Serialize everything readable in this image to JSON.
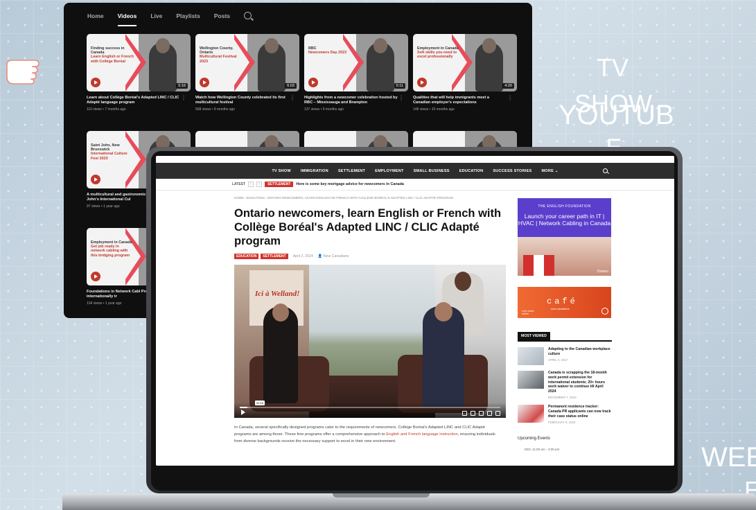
{
  "floating_labels": {
    "tv": "TV",
    "show": "SHOW",
    "youtube": "YOUTUB",
    "e": "E",
    "web": "WEE",
    "e2": "E"
  },
  "youtube": {
    "tabs": [
      "Home",
      "Videos",
      "Live",
      "Playlists",
      "Posts"
    ],
    "active_tab": "Videos",
    "videos": [
      {
        "thumb_kicker": "Finding success in Canada",
        "thumb_title": "Learn English or French with Collège Boréal",
        "duration": "5:16",
        "title": "Learn about Collège Boréal's Adapted LINC / CLIC Adapté language program",
        "meta": "110 views • 7 months ago"
      },
      {
        "thumb_kicker": "Wellington County, Ontario",
        "thumb_title": "Multicultural Festival 2023",
        "duration": "6:03",
        "title": "Watch how Wellington County celebrated its first multicultural festival",
        "meta": "568 views • 9 months ago"
      },
      {
        "thumb_kicker": "RBC",
        "thumb_title": "Newcomers Day 2023",
        "duration": "5:11",
        "title": "Highlights from a newcomer celebration hosted by RBC – Mississauga and Brampton",
        "meta": "137 views • 9 months ago"
      },
      {
        "thumb_kicker": "Employment in Canada",
        "thumb_title": "Soft skills you need to excel professionally",
        "duration": "4:20",
        "title": "Qualities that will help immigrants meet a Canadian employer's expectations",
        "meta": "148 views • 10 months ago"
      },
      {
        "thumb_kicker": "Saint John, New Brunswick",
        "thumb_title": "International Culture Fest 2023",
        "duration": "",
        "title": "A multicultural and gastronomic celebration: Saint John's International Cul",
        "meta": "97 views • 1 year ago"
      },
      {
        "thumb_kicker": "",
        "thumb_title": "",
        "duration": "",
        "title": "",
        "meta": ""
      },
      {
        "thumb_kicker": "",
        "thumb_title": "",
        "duration": "",
        "title": "",
        "meta": ""
      },
      {
        "thumb_kicker": "",
        "thumb_title": "",
        "duration": "",
        "title": "",
        "meta": ""
      },
      {
        "thumb_kicker": "Employment in Canada",
        "thumb_title": "Get job ready in network cabling with this bridging program",
        "duration": "",
        "title": "Foundations in Network Cabl Program for internationally tr",
        "meta": "134 views • 1 year ago"
      }
    ]
  },
  "site": {
    "nav": [
      "TV SHOW",
      "IMMIGRATION",
      "SETTLEMENT",
      "EMPLOYMENT",
      "SMALL BUSINESS",
      "EDUCATION",
      "SUCCESS STORIES",
      "MORE"
    ],
    "ticker_label": "LATEST",
    "ticker_tag": "SETTLEMENT",
    "ticker_text": "Here is some key mortgage advice for newcomers in Canada",
    "breadcrumb": "HOME  ›  EDUCATION  ›  ONTARIO NEWCOMERS, LEARN ENGLISH OR FRENCH WITH COLLÈGE BORÉAL'S ADAPTED LINC / CLIC ADAPTÉ PROGRAM",
    "headline": "Ontario newcomers, learn English or French with Collège Boréal's Adapted LINC / CLIC Adapté program",
    "tags": [
      "EDUCATION",
      "SETTLEMENT"
    ],
    "date": "April 2, 2024",
    "author": "New Canadians",
    "video_sign": "Ici à Welland!",
    "video_time": "00:16",
    "video_progress": 0.03,
    "body_pre": "In Canada, several specifically designed programs cater to the requirements of newcomers. Collège Boréal's Adapted LINC and CLIC Adapté programs are among those. These free programs offer a comprehensive approach to ",
    "body_link": "English and French language instruction",
    "body_post": ", ensuring individuals from diverse backgrounds receive the necessary support to excel in their new environment.",
    "ad1": {
      "logo": "THE ENGLISH FOUNDATION",
      "headline": "Launch your career path in IT | HVAC | Network Cabling in Canada",
      "foot": "Ontario"
    },
    "ad2": {
      "logo": "Let's meet online",
      "text": "café",
      "sub": "new canadians"
    },
    "most_viewed_title": "MOST VIEWED",
    "most_viewed": [
      {
        "title": "Adapting to the Canadian workplace culture",
        "date": "APRIL 3, 2017"
      },
      {
        "title": "Canada is scrapping the 18-month work permit extension for international students; 20+ hours work waiver to continue till April 2024",
        "date": "DECEMBER 7, 2023"
      },
      {
        "title": "Permanent residence tracker: Canada PR applicants can now track their case status online",
        "date": "FEBRUARY 8, 2022"
      }
    ],
    "events_title": "Upcoming Events",
    "event_row": "DEC   11:00 am - 3:00 pm"
  }
}
